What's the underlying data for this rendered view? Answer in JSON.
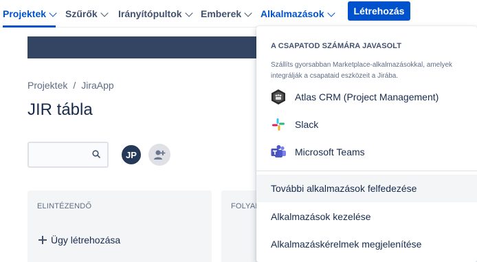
{
  "nav": {
    "items": [
      {
        "label": "Projektek"
      },
      {
        "label": "Szűrők"
      },
      {
        "label": "Irányítópultok"
      },
      {
        "label": "Emberek"
      },
      {
        "label": "Alkalmazások"
      }
    ],
    "create_label": "Létrehozás"
  },
  "breadcrumb": {
    "items": [
      "Projektek",
      "/",
      "JiraApp"
    ]
  },
  "page": {
    "title": "JIR tábla"
  },
  "toolbar": {
    "avatar_initials": "JP"
  },
  "board": {
    "columns": [
      {
        "header": "ELINTÉZENDŐ",
        "create_issue": "Ügy létrehozása"
      },
      {
        "header": "FOLYAMATBAN"
      }
    ]
  },
  "dropdown": {
    "heading": "A CSAPATOD SZÁMÁRA JAVASOLT",
    "description": "Szállíts gyorsabban Marketplace-alkalmazásokkal, amelyek integrálják a csapataid eszközeit a Jirába.",
    "apps": [
      {
        "label": "Atlas CRM (Project Management)",
        "icon": "atlas-crm-icon"
      },
      {
        "label": "Slack",
        "icon": "slack-icon"
      },
      {
        "label": "Microsoft Teams",
        "icon": "microsoft-teams-icon"
      }
    ],
    "links": [
      {
        "label": "További alkalmazások felfedezése"
      },
      {
        "label": "Alkalmazások kezelése"
      },
      {
        "label": "Alkalmazáskérelmek megjelenítése"
      }
    ]
  },
  "colors": {
    "primary": "#0052cc",
    "text": "#172b4d",
    "banner": "#344563",
    "column_bg": "#f4f5f7"
  }
}
